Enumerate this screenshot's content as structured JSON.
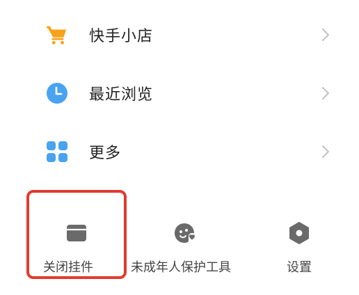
{
  "menu": {
    "items": [
      {
        "label": "快手小店",
        "icon": "cart-icon"
      },
      {
        "label": "最近浏览",
        "icon": "clock-icon"
      },
      {
        "label": "更多",
        "icon": "grid-icon"
      }
    ]
  },
  "toolbar": {
    "items": [
      {
        "label": "关闭挂件",
        "icon": "envelope-icon"
      },
      {
        "label": "未成年人保护工具",
        "icon": "child-protection-icon"
      },
      {
        "label": "设置",
        "icon": "settings-hexagon-icon"
      }
    ]
  },
  "colors": {
    "cart": "#f7a21b",
    "clock": "#4aa3f0",
    "grid": "#4aa3f0",
    "toolbar_icon": "#6a6a6a",
    "highlight": "#e23a2e"
  }
}
